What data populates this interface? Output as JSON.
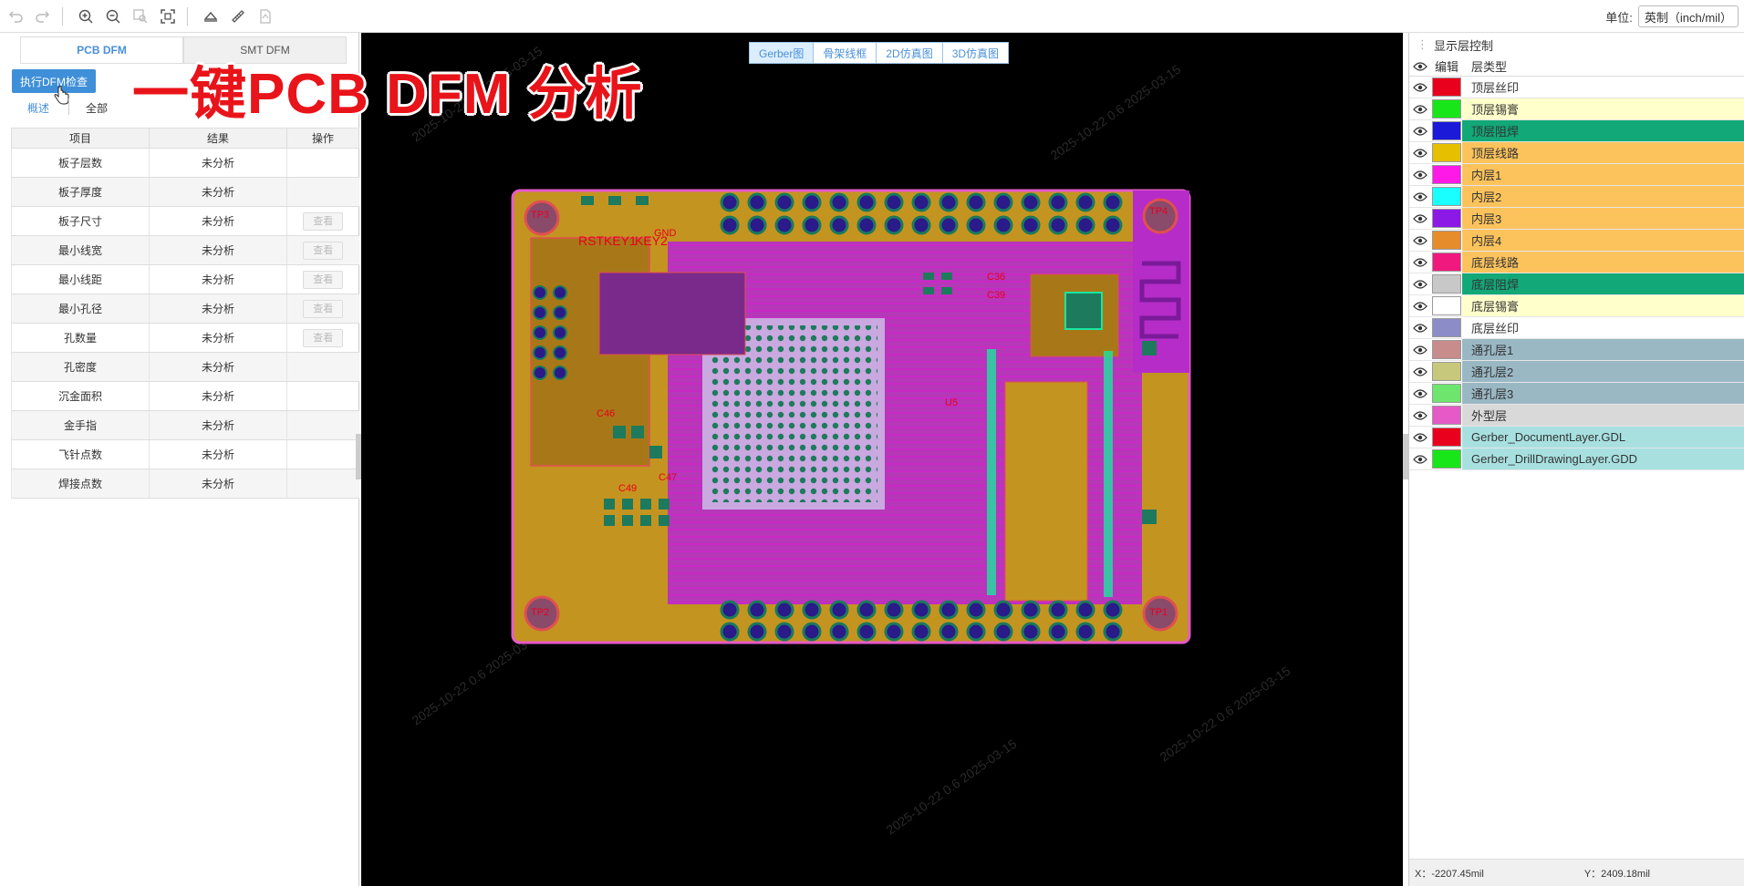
{
  "toolbar": {
    "icons": [
      "undo-icon",
      "redo-icon",
      "zoom-in-icon",
      "zoom-out-icon",
      "zoom-window-icon",
      "fit-view-icon",
      "stack-icon",
      "measure-icon",
      "pdf-icon"
    ]
  },
  "unit": {
    "label": "单位:",
    "value": "英制（inch/mil）"
  },
  "left": {
    "tabs": [
      "PCB DFM",
      "SMT DFM"
    ],
    "active_tab": 0,
    "run_button": "执行DFM检查",
    "sub_tabs": [
      "概述",
      "全部"
    ],
    "table": {
      "headers": [
        "项目",
        "结果",
        "操作"
      ],
      "rows": [
        {
          "item": "板子层数",
          "result": "未分析",
          "action": ""
        },
        {
          "item": "板子厚度",
          "result": "未分析",
          "action": ""
        },
        {
          "item": "板子尺寸",
          "result": "未分析",
          "action": "查看"
        },
        {
          "item": "最小线宽",
          "result": "未分析",
          "action": "查看"
        },
        {
          "item": "最小线距",
          "result": "未分析",
          "action": "查看"
        },
        {
          "item": "最小孔径",
          "result": "未分析",
          "action": "查看"
        },
        {
          "item": "孔数量",
          "result": "未分析",
          "action": "查看"
        },
        {
          "item": "孔密度",
          "result": "未分析",
          "action": ""
        },
        {
          "item": "沉金面积",
          "result": "未分析",
          "action": ""
        },
        {
          "item": "金手指",
          "result": "未分析",
          "action": ""
        },
        {
          "item": "飞针点数",
          "result": "未分析",
          "action": ""
        },
        {
          "item": "焊接点数",
          "result": "未分析",
          "action": ""
        }
      ]
    }
  },
  "overlay_title": "一键PCB DFM 分析",
  "view_tabs": [
    "Gerber图",
    "骨架线框",
    "2D仿真图",
    "3D仿真图"
  ],
  "active_view": 0,
  "right": {
    "title": "显示层控制",
    "headers": {
      "edit": "编辑",
      "type": "层类型"
    },
    "layers": [
      {
        "name": "顶层丝印",
        "color": "#e8001c",
        "bg": "#ffffff"
      },
      {
        "name": "顶层锡膏",
        "color": "#19e619",
        "bg": "#ffffcc"
      },
      {
        "name": "顶层阻焊",
        "color": "#1a1ad8",
        "bg": "#12a878"
      },
      {
        "name": "顶层线路",
        "color": "#e6c000",
        "bg": "#fcc35c"
      },
      {
        "name": "内层1",
        "color": "#ff19e6",
        "bg": "#fcc35c"
      },
      {
        "name": "内层2",
        "color": "#19ffff",
        "bg": "#fcc35c"
      },
      {
        "name": "内层3",
        "color": "#8c19e6",
        "bg": "#fcc35c"
      },
      {
        "name": "内层4",
        "color": "#e68c2a",
        "bg": "#fcc35c"
      },
      {
        "name": "底层线路",
        "color": "#f0197d",
        "bg": "#fcc35c"
      },
      {
        "name": "底层阻焊",
        "color": "#c8c8c8",
        "bg": "#12a878"
      },
      {
        "name": "底层锡膏",
        "color": "#ffffff",
        "bg": "#ffffcc"
      },
      {
        "name": "底层丝印",
        "color": "#8c8cc8",
        "bg": "#ffffff"
      },
      {
        "name": "通孔层1",
        "color": "#c88c8c",
        "bg": "#9ab8c4"
      },
      {
        "name": "通孔层2",
        "color": "#c8c87d",
        "bg": "#9ab8c4"
      },
      {
        "name": "通孔层3",
        "color": "#6ee66e",
        "bg": "#9ab8c4"
      },
      {
        "name": "外型层",
        "color": "#e65ac8",
        "bg": "#d9d9d9"
      },
      {
        "name": "Gerber_DocumentLayer.GDL",
        "color": "#e8001c",
        "bg": "#a8e0e0"
      },
      {
        "name": "Gerber_DrillDrawingLayer.GDD",
        "color": "#19e619",
        "bg": "#a8e0e0"
      }
    ],
    "coords": {
      "x": "X：-2207.45mil",
      "y": "Y：2409.18mil"
    }
  },
  "pcb": {
    "labels": [
      "TP3",
      "TP4",
      "TP2",
      "TP1",
      "RST",
      "KEY1",
      "KEY2",
      "GND",
      "U5",
      "C36",
      "C39",
      "C47",
      "C46",
      "C49"
    ]
  },
  "watermark": "2025-10-22 0.6 2025-03-15"
}
